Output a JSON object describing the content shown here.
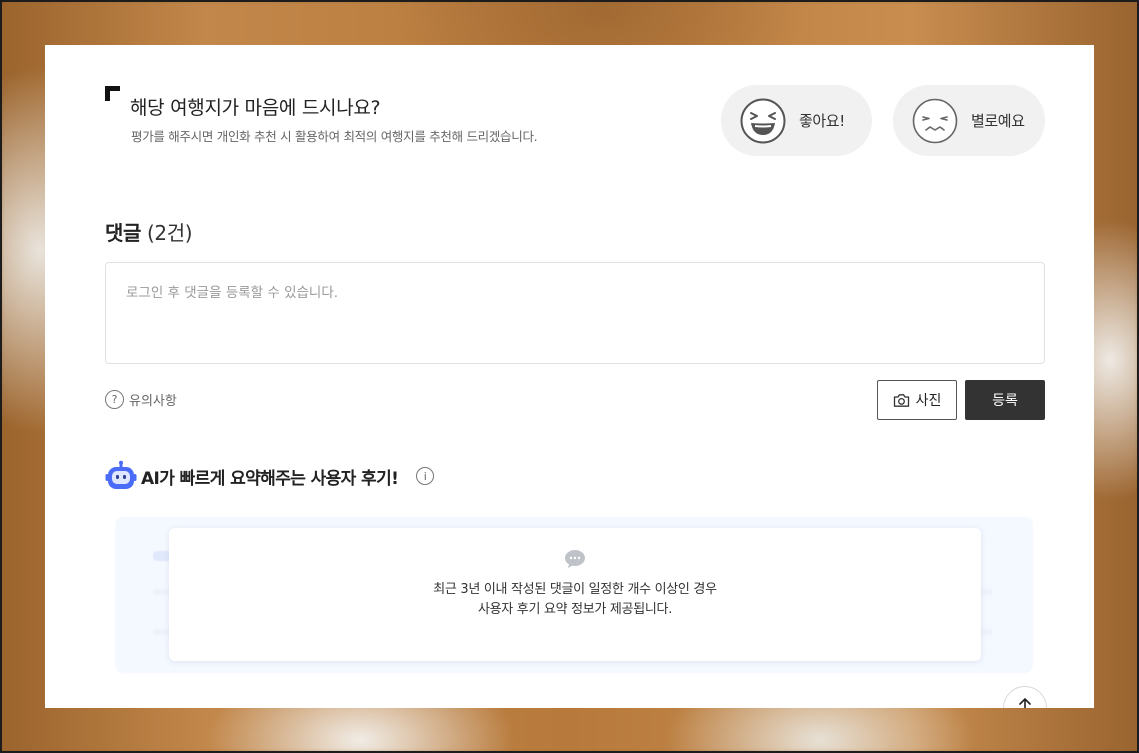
{
  "rating": {
    "title": "해당 여행지가 마음에 드시나요?",
    "subtitle": "평가를 해주시면 개인화 추천 시 활용하여 최적의 여행지를 추천해 드리겠습니다.",
    "good_label": "좋아요!",
    "bad_label": "별로예요"
  },
  "comments": {
    "heading": "댓글",
    "count": "(2건)",
    "placeholder": "로그인 후 댓글을 등록할 수 있습니다.",
    "notice_label": "유의사항",
    "photo_label": "사진",
    "submit_label": "등록"
  },
  "ai_summary": {
    "title": "AI가 빠르게 요약해주는 사용자 후기!",
    "message_line1": "최근 3년 이내 작성된 댓글이 일정한 개수 이상인 경우",
    "message_line2": "사용자 후기 요약 정보가 제공됩니다."
  },
  "icons": {
    "notice": "question-icon",
    "photo": "camera-icon",
    "info": "info-icon",
    "bubble": "chat-bubble-icon",
    "top": "arrow-up-icon"
  },
  "colors": {
    "submit_bg": "#333333",
    "ai_accent": "#4a6cf7",
    "rate_bg": "#f1f1f1"
  }
}
